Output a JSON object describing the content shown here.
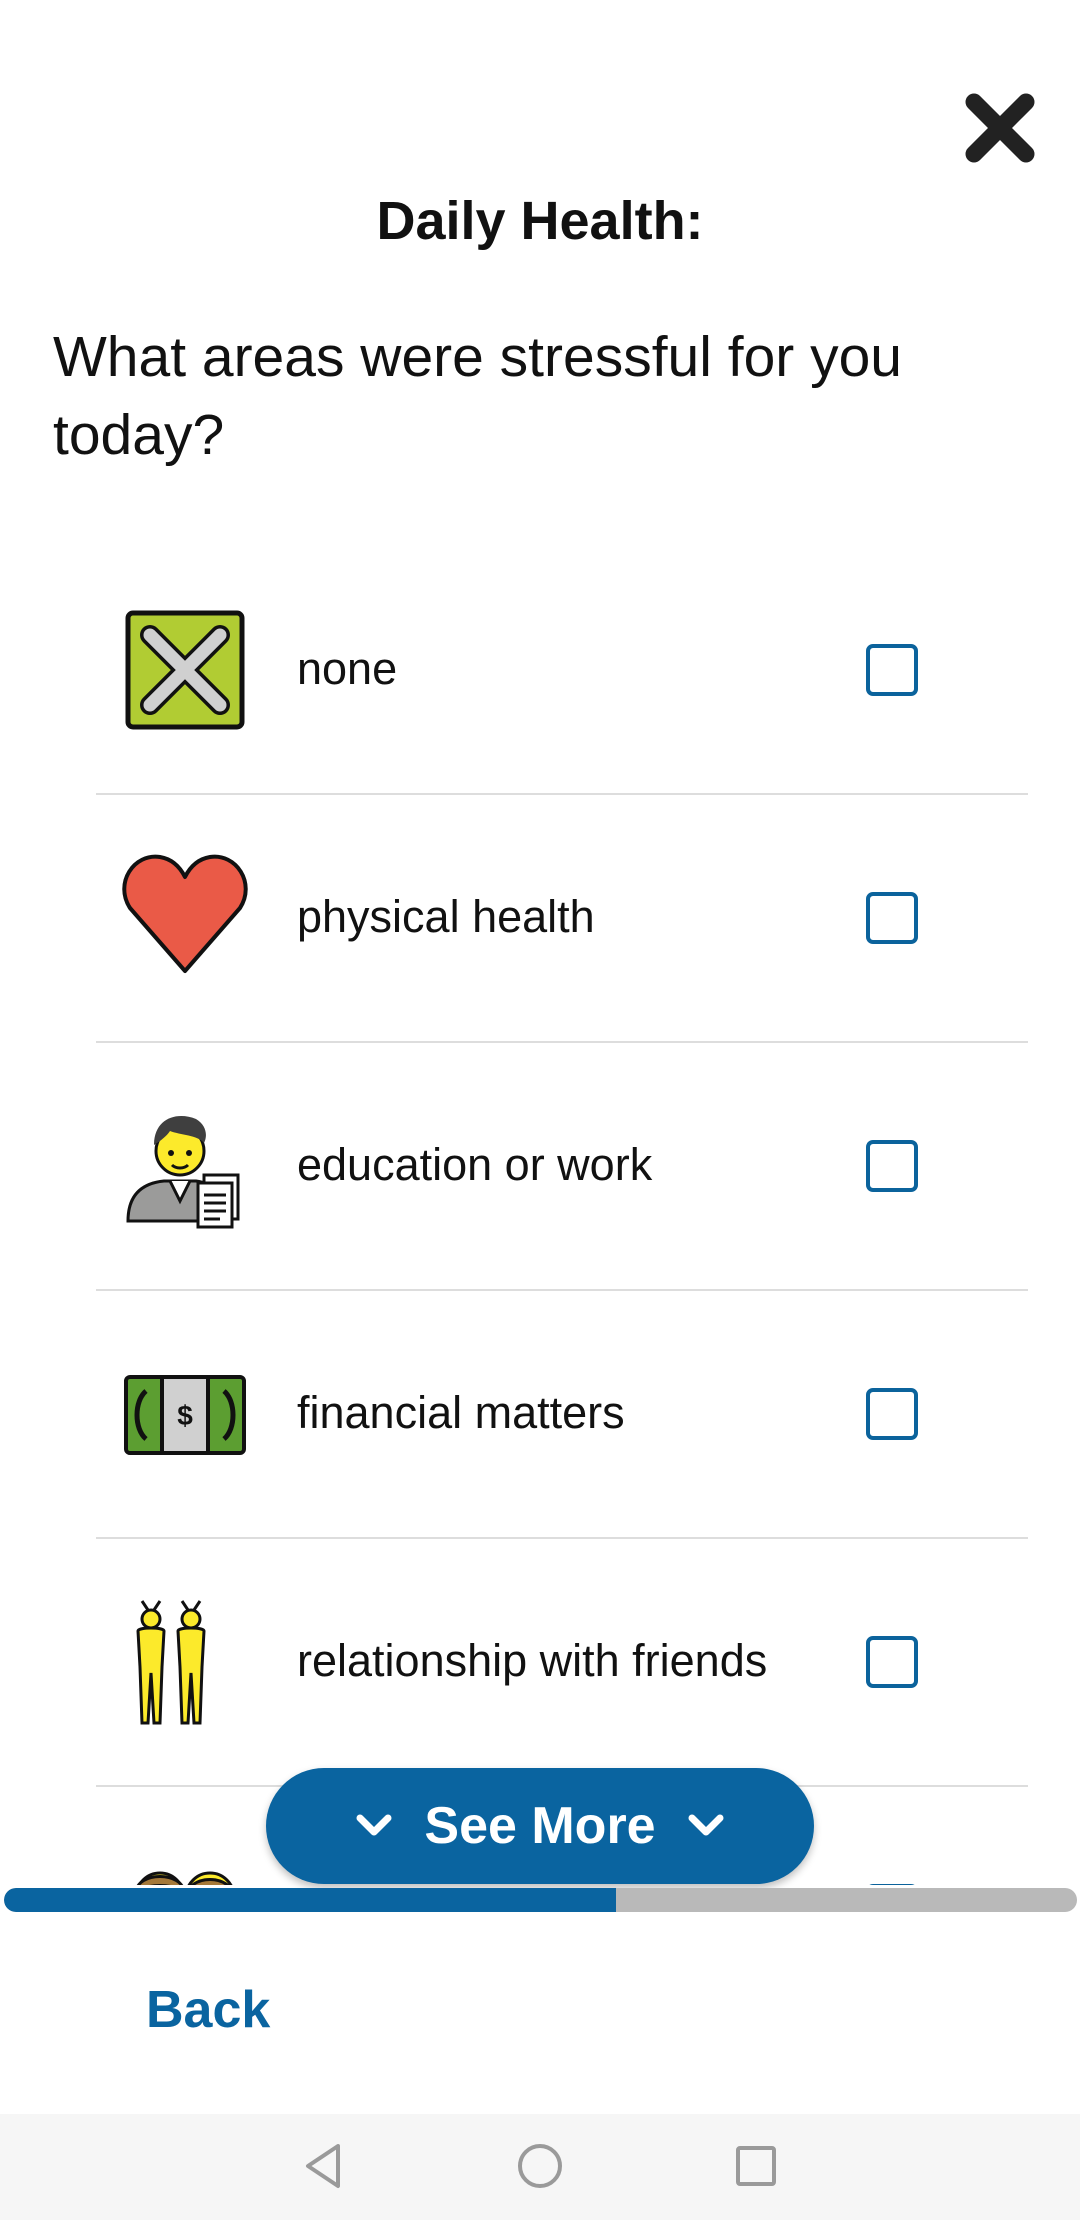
{
  "header": {
    "close_icon": "close-icon",
    "title": "Daily Health:"
  },
  "question": "What areas were stressful for you today?",
  "options": [
    {
      "label": "none",
      "icon": "x-box-icon",
      "checked": false
    },
    {
      "label": "physical health",
      "icon": "heart-icon",
      "checked": false
    },
    {
      "label": "education or work",
      "icon": "worker-document-icon",
      "checked": false
    },
    {
      "label": "financial matters",
      "icon": "money-bill-icon",
      "checked": false
    },
    {
      "label": "relationship with friends",
      "icon": "friends-icon",
      "checked": false
    },
    {
      "label": "",
      "icon": "couple-icon",
      "checked": false
    }
  ],
  "see_more": {
    "label": "See More"
  },
  "progress": {
    "fraction": 0.57
  },
  "footer": {
    "back_label": "Back"
  },
  "nav": {
    "back": "nav-back-icon",
    "home": "nav-home-icon",
    "recents": "nav-recents-icon"
  },
  "colors": {
    "accent": "#0a64a0",
    "track": "#b9b9b9",
    "heart": "#ea5a47",
    "x_box": "#b1cc33",
    "money": "#5c9e31"
  }
}
